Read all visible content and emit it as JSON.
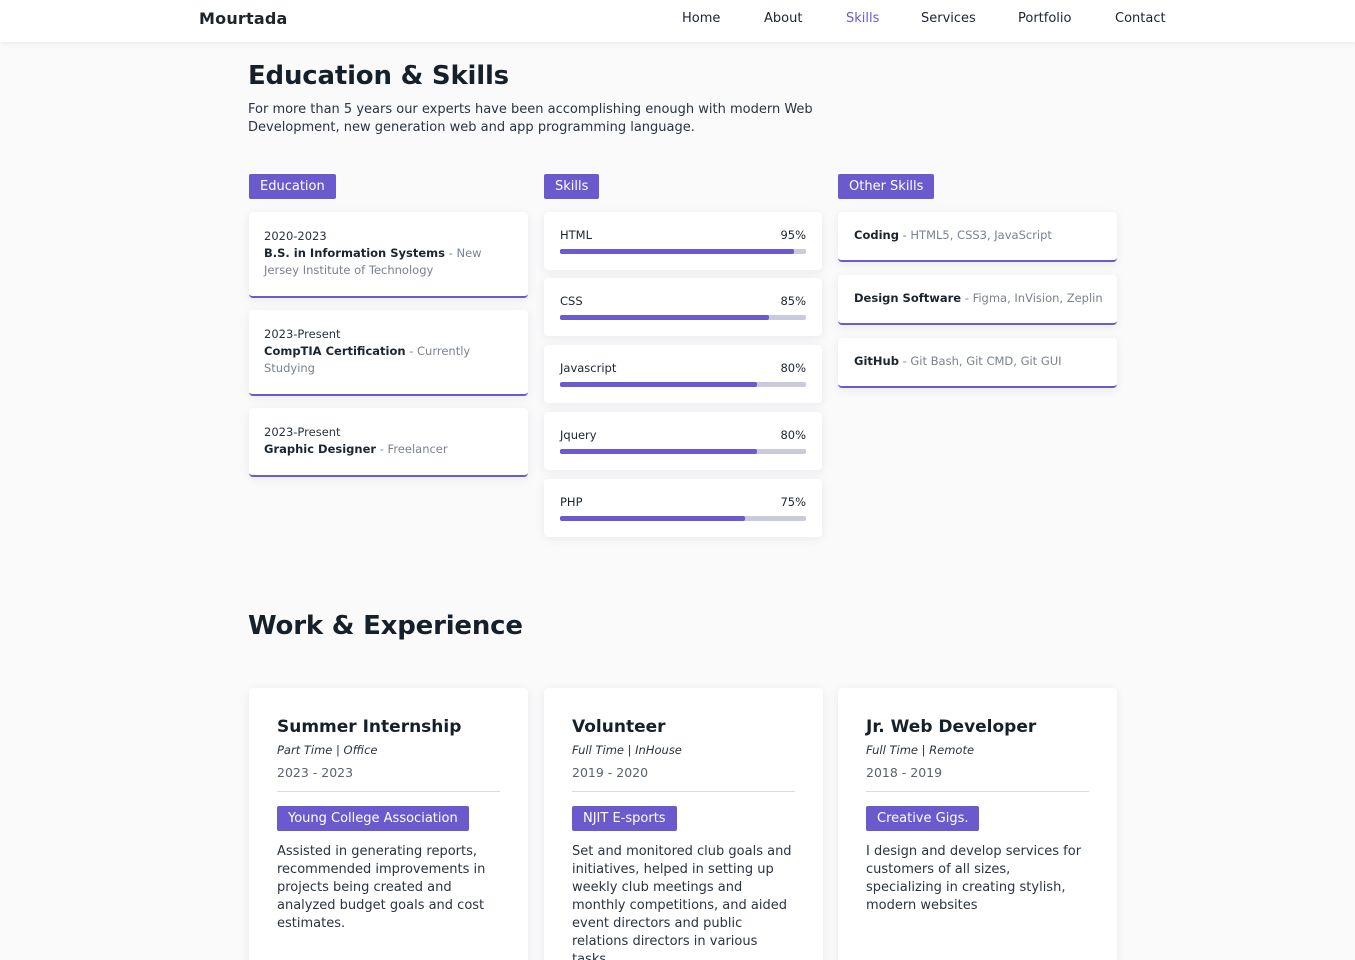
{
  "navbar": {
    "brand": "Mourtada",
    "links": [
      {
        "label": "Home",
        "active": false
      },
      {
        "label": "About",
        "active": false
      },
      {
        "label": "Skills",
        "active": true
      },
      {
        "label": "Services",
        "active": false
      },
      {
        "label": "Portfolio",
        "active": false
      },
      {
        "label": "Contact",
        "active": false
      }
    ]
  },
  "education_skills": {
    "title": "Education & Skills",
    "intro": "For more than 5 years our experts have been accomplishing enough with modern Web Development, new generation web and app programming language.",
    "education": {
      "tag": "Education",
      "items": [
        {
          "date": "2020-2023",
          "degree": "B.S. in Information Systems",
          "sep": " - ",
          "place": "New Jersey Institute of Technology"
        },
        {
          "date": "2023-Present",
          "degree": "CompTIA Certification",
          "sep": " - ",
          "place": "Currently Studying"
        },
        {
          "date": "2023-Present",
          "degree": "Graphic Designer",
          "sep": " - ",
          "place": "Freelancer"
        }
      ]
    },
    "skills": {
      "tag": "Skills",
      "items": [
        {
          "name": "HTML",
          "percent_label": "95%",
          "percent": 95
        },
        {
          "name": "CSS",
          "percent_label": "85%",
          "percent": 85
        },
        {
          "name": "Javascript",
          "percent_label": "80%",
          "percent": 80
        },
        {
          "name": "Jquery",
          "percent_label": "80%",
          "percent": 80
        },
        {
          "name": "PHP",
          "percent_label": "75%",
          "percent": 75
        }
      ]
    },
    "other_skills": {
      "tag": "Other Skills",
      "items": [
        {
          "name": "Coding",
          "sep": " - ",
          "detail": "HTML5, CSS3, JavaScript"
        },
        {
          "name": "Design Software",
          "sep": " - ",
          "detail": "Figma, InVision, Zeplin"
        },
        {
          "name": "GitHub",
          "sep": " - ",
          "detail": "Git Bash, Git CMD, Git GUI"
        }
      ]
    }
  },
  "work": {
    "title": "Work & Experience",
    "items": [
      {
        "title": "Summer Internship",
        "type": "Part Time | Office",
        "years": "2023 - 2023",
        "org": "Young College Association",
        "desc": "Assisted in generating reports, recommended improvements in projects being created and analyzed budget goals and cost estimates."
      },
      {
        "title": "Volunteer",
        "type": "Full Time | InHouse",
        "years": "2019 - 2020",
        "org": "NJIT E-sports",
        "desc": "Set and monitored club goals and initiatives, helped in setting up weekly club meetings and monthly competitions, and aided event directors and public relations directors in various tasks."
      },
      {
        "title": "Jr. Web Developer",
        "type": "Full Time | Remote",
        "years": "2018 - 2019",
        "org": "Creative Gigs.",
        "desc": "I design and develop services for customers of all sizes, specializing in creating stylish, modern websites"
      }
    ]
  }
}
